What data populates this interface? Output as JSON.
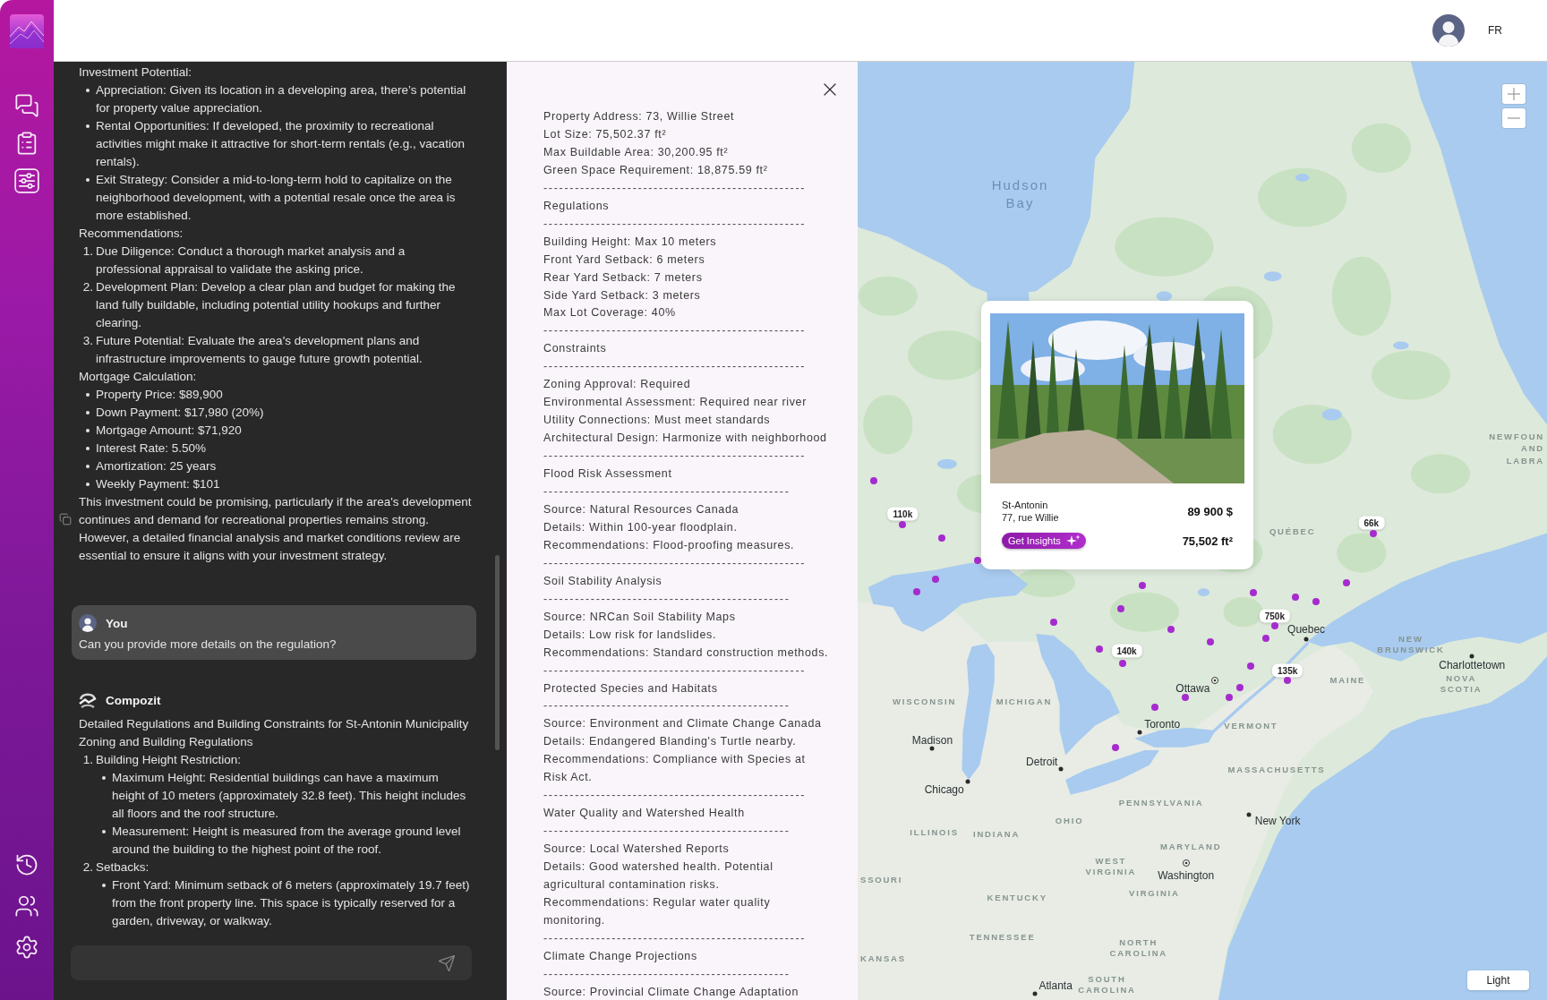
{
  "header": {
    "language": "FR"
  },
  "chat": {
    "messages": [
      {
        "kind": "continued",
        "blocks": [
          {
            "kind": "p",
            "text": "Investment Potential:"
          },
          {
            "kind": "ul",
            "items": [
              {
                "text": "Appreciation: Given its location in a developing area, there’s potential for property value appreciation."
              },
              {
                "text": "Rental Opportunities: If developed, the proximity to recreational activities might make it attractive for short-term rentals (e.g., vacation rentals)."
              },
              {
                "text": "Exit Strategy: Consider a mid-to-long-term hold to capitalize on the neighborhood development, with a potential resale once the area is more established."
              }
            ]
          },
          {
            "kind": "p",
            "text": "Recommendations:"
          },
          {
            "kind": "ol",
            "items": [
              {
                "marker": "1.",
                "text": "Due Diligence: Conduct a thorough market analysis and a professional appraisal to validate the asking price."
              },
              {
                "marker": "2.",
                "text": "Development Plan: Develop a clear plan and budget for making the land fully buildable, including potential utility hookups and further clearing."
              },
              {
                "marker": "3.",
                "text": "Future Potential: Evaluate the area's development plans and infrastructure improvements to gauge future growth potential."
              }
            ]
          },
          {
            "kind": "p",
            "text": "Mortgage Calculation:"
          },
          {
            "kind": "ul",
            "items": [
              {
                "text": "Property Price: $89,900"
              },
              {
                "text": "Down Payment: $17,980 (20%)"
              },
              {
                "text": "Mortgage Amount: $71,920"
              },
              {
                "text": "Interest Rate: 5.50%"
              },
              {
                "text": "Amortization: 25 years"
              },
              {
                "text": "Weekly Payment: $101"
              }
            ]
          },
          {
            "kind": "p",
            "text": "This investment could be promising, particularly if the area's development continues and demand for recreational properties remains strong. However, a detailed financial analysis and market conditions review are essential to ensure it aligns with your investment strategy."
          }
        ]
      },
      {
        "kind": "user",
        "author": "You",
        "text": "Can you provide more details on the regulation?"
      },
      {
        "kind": "assistant",
        "author": "Compozit",
        "blocks": [
          {
            "kind": "p",
            "text": "Detailed Regulations and Building Constraints for St-Antonin Municipality"
          },
          {
            "kind": "p",
            "text": "Zoning and Building Regulations"
          },
          {
            "kind": "ol",
            "items": [
              {
                "marker": "1.",
                "text": "Building Height Restriction:",
                "children": [
                  {
                    "text": "Maximum Height: Residential buildings can have a maximum height of 10 meters (approximately 32.8 feet). This height includes all floors and the roof structure."
                  },
                  {
                    "text": "Measurement: Height is measured from the average ground level around the building to the highest point of the roof."
                  }
                ]
              },
              {
                "marker": "2.",
                "text": "Setbacks:",
                "children": [
                  {
                    "text": "Front Yard: Minimum setback of 6 meters (approximately 19.7 feet) from the front property line. This space is typically reserved for a garden, driveway, or walkway."
                  }
                ]
              }
            ]
          }
        ]
      }
    ]
  },
  "report": {
    "intro": [
      "Property Address: 73, Willie Street",
      "Lot Size: 75,502.37 ft²",
      "Max Buildable Area: 30,200.95 ft²",
      "Green Space Requirement: 18,875.59 ft²"
    ],
    "sections": [
      {
        "rule_above": "--------------------------------------------------",
        "title": "Regulations",
        "rule_below": "--------------------------------------------------",
        "lines": [
          "Building Height: Max 10 meters",
          "Front Yard Setback: 6 meters",
          "Rear Yard Setback: 7 meters",
          "Side Yard Setback: 3 meters",
          "Max Lot Coverage: 40%"
        ]
      },
      {
        "rule_above": "--------------------------------------------------",
        "title": "Constraints",
        "rule_below": "--------------------------------------------------",
        "lines": [
          "Zoning Approval: Required",
          "Environmental Assessment: Required near river",
          "Utility Connections: Must meet standards",
          "Architectural Design: Harmonize with neighborhood"
        ]
      },
      {
        "rule_above": "--------------------------------------------------",
        "title": "Flood Risk Assessment",
        "rule_below": "-----------------------------------------------",
        "lines": [
          "Source: Natural Resources Canada",
          "Details: Within 100-year floodplain.",
          "Recommendations: Flood-proofing measures."
        ]
      },
      {
        "rule_above": "--------------------------------------------------",
        "title": "Soil Stability Analysis",
        "rule_below": "-----------------------------------------------",
        "lines": [
          "Source: NRCan Soil Stability Maps",
          "Details: Low risk for landslides.",
          "Recommendations: Standard construction methods."
        ]
      },
      {
        "rule_above": "--------------------------------------------------",
        "title": "Protected Species and Habitats",
        "rule_below": "-----------------------------------------------",
        "lines": [
          "Source: Environment and Climate Change Canada",
          "Details: Endangered Blanding's Turtle nearby.",
          "Recommendations: Compliance with Species at Risk Act."
        ]
      },
      {
        "rule_above": "--------------------------------------------------",
        "title": "Water Quality and Watershed Health",
        "rule_below": "-----------------------------------------------",
        "lines": [
          "Source: Local Watershed Reports",
          "Details: Good watershed health. Potential agricultural contamination risks.",
          "Recommendations: Regular water quality monitoring."
        ]
      },
      {
        "rule_above": "--------------------------------------------------",
        "title": "Climate Change Projections",
        "rule_below": "-----------------------------------------------",
        "lines": [
          "Source: Provincial Climate Change Adaptation"
        ]
      }
    ]
  },
  "map": {
    "place_labels": [
      {
        "text": "Hudson Bay",
        "kind": "water"
      },
      {
        "text": "NEWFOUN",
        "kind": "region"
      },
      {
        "text": "AND",
        "kind": "region"
      },
      {
        "text": "LABRA",
        "kind": "region"
      },
      {
        "text": "QUÉBEC",
        "kind": "region"
      },
      {
        "text": "Quebec",
        "kind": "city"
      },
      {
        "text": "NEW BRUNSWICK",
        "kind": "region"
      },
      {
        "text": "Charlottetown",
        "kind": "city"
      },
      {
        "text": "Ottawa",
        "kind": "capital"
      },
      {
        "text": "MAINE",
        "kind": "region"
      },
      {
        "text": "NOVA SCOTIA",
        "kind": "region"
      },
      {
        "text": "WISCONSIN",
        "kind": "region"
      },
      {
        "text": "MICHIGAN",
        "kind": "region"
      },
      {
        "text": "Toronto",
        "kind": "city"
      },
      {
        "text": "VERMONT",
        "kind": "region"
      },
      {
        "text": "Madison",
        "kind": "city"
      },
      {
        "text": "Detroit",
        "kind": "city"
      },
      {
        "text": "MASSACHUSETTS",
        "kind": "region"
      },
      {
        "text": "Chicago",
        "kind": "city"
      },
      {
        "text": "PENNSYLVANIA",
        "kind": "region"
      },
      {
        "text": "OHIO",
        "kind": "region"
      },
      {
        "text": "New York",
        "kind": "city"
      },
      {
        "text": "ILLINOIS",
        "kind": "region"
      },
      {
        "text": "INDIANA",
        "kind": "region"
      },
      {
        "text": "MARYLAND",
        "kind": "region"
      },
      {
        "text": "SSOURI",
        "kind": "region"
      },
      {
        "text": "WEST VIRGINIA",
        "kind": "region"
      },
      {
        "text": "Washington",
        "kind": "capital"
      },
      {
        "text": "KENTUCKY",
        "kind": "region"
      },
      {
        "text": "VIRGINIA",
        "kind": "region"
      },
      {
        "text": "TENNESSEE",
        "kind": "region"
      },
      {
        "text": "KANSAS",
        "kind": "region"
      },
      {
        "text": "NORTH CAROLINA",
        "kind": "region"
      },
      {
        "text": "Atlanta",
        "kind": "city"
      },
      {
        "text": "SOUTH CAROLINA",
        "kind": "region"
      }
    ],
    "price_pins": [
      {
        "label": "110k"
      },
      {
        "label": "66k"
      },
      {
        "label": "750k"
      },
      {
        "label": "140k"
      },
      {
        "label": "135k"
      }
    ],
    "listing_card": {
      "town": "St-Antonin",
      "street": "77, rue Willie",
      "price": "89 900 $",
      "area": "75,502 ft²",
      "button": "Get Insights"
    },
    "theme_button": "Light"
  }
}
